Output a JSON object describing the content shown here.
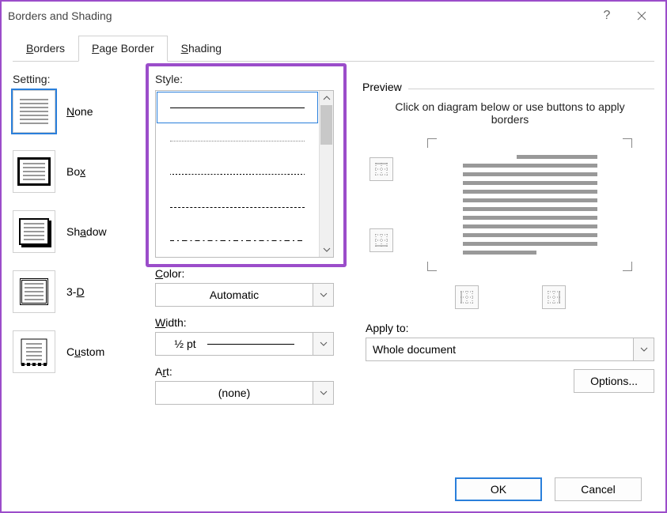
{
  "window": {
    "title": "Borders and Shading"
  },
  "tabs": {
    "borders_pre": "",
    "borders_ul": "B",
    "borders_post": "orders",
    "page_pre": "",
    "page_ul": "P",
    "page_post": "age Border",
    "shading_pre": "",
    "shading_ul": "S",
    "shading_post": "hading"
  },
  "setting": {
    "label": "Setting:",
    "none_pre": "",
    "none_ul": "N",
    "none_post": "one",
    "box_pre": "Bo",
    "box_ul": "x",
    "box_post": "",
    "shadow_pre": "Sh",
    "shadow_ul": "a",
    "shadow_post": "dow",
    "threeD_pre": "3-",
    "threeD_ul": "D",
    "threeD_post": "",
    "custom_pre": "C",
    "custom_ul": "u",
    "custom_post": "stom"
  },
  "middle": {
    "style_pre": "St",
    "style_ul": "y",
    "style_post": "le:",
    "color_pre": "",
    "color_ul": "C",
    "color_post": "olor:",
    "color_value": "Automatic",
    "width_pre": "",
    "width_ul": "W",
    "width_post": "idth:",
    "width_value": "½ pt",
    "art_pre": "A",
    "art_ul": "r",
    "art_post": "t:",
    "art_value": "(none)"
  },
  "preview": {
    "legend": "Preview",
    "hint": "Click on diagram below or use buttons to apply borders",
    "apply_pre": "App",
    "apply_ul": "l",
    "apply_post": "y to:",
    "apply_value": "Whole document",
    "options_pre": "",
    "options_ul": "O",
    "options_post": "ptions..."
  },
  "footer": {
    "ok": "OK",
    "cancel": "Cancel"
  }
}
